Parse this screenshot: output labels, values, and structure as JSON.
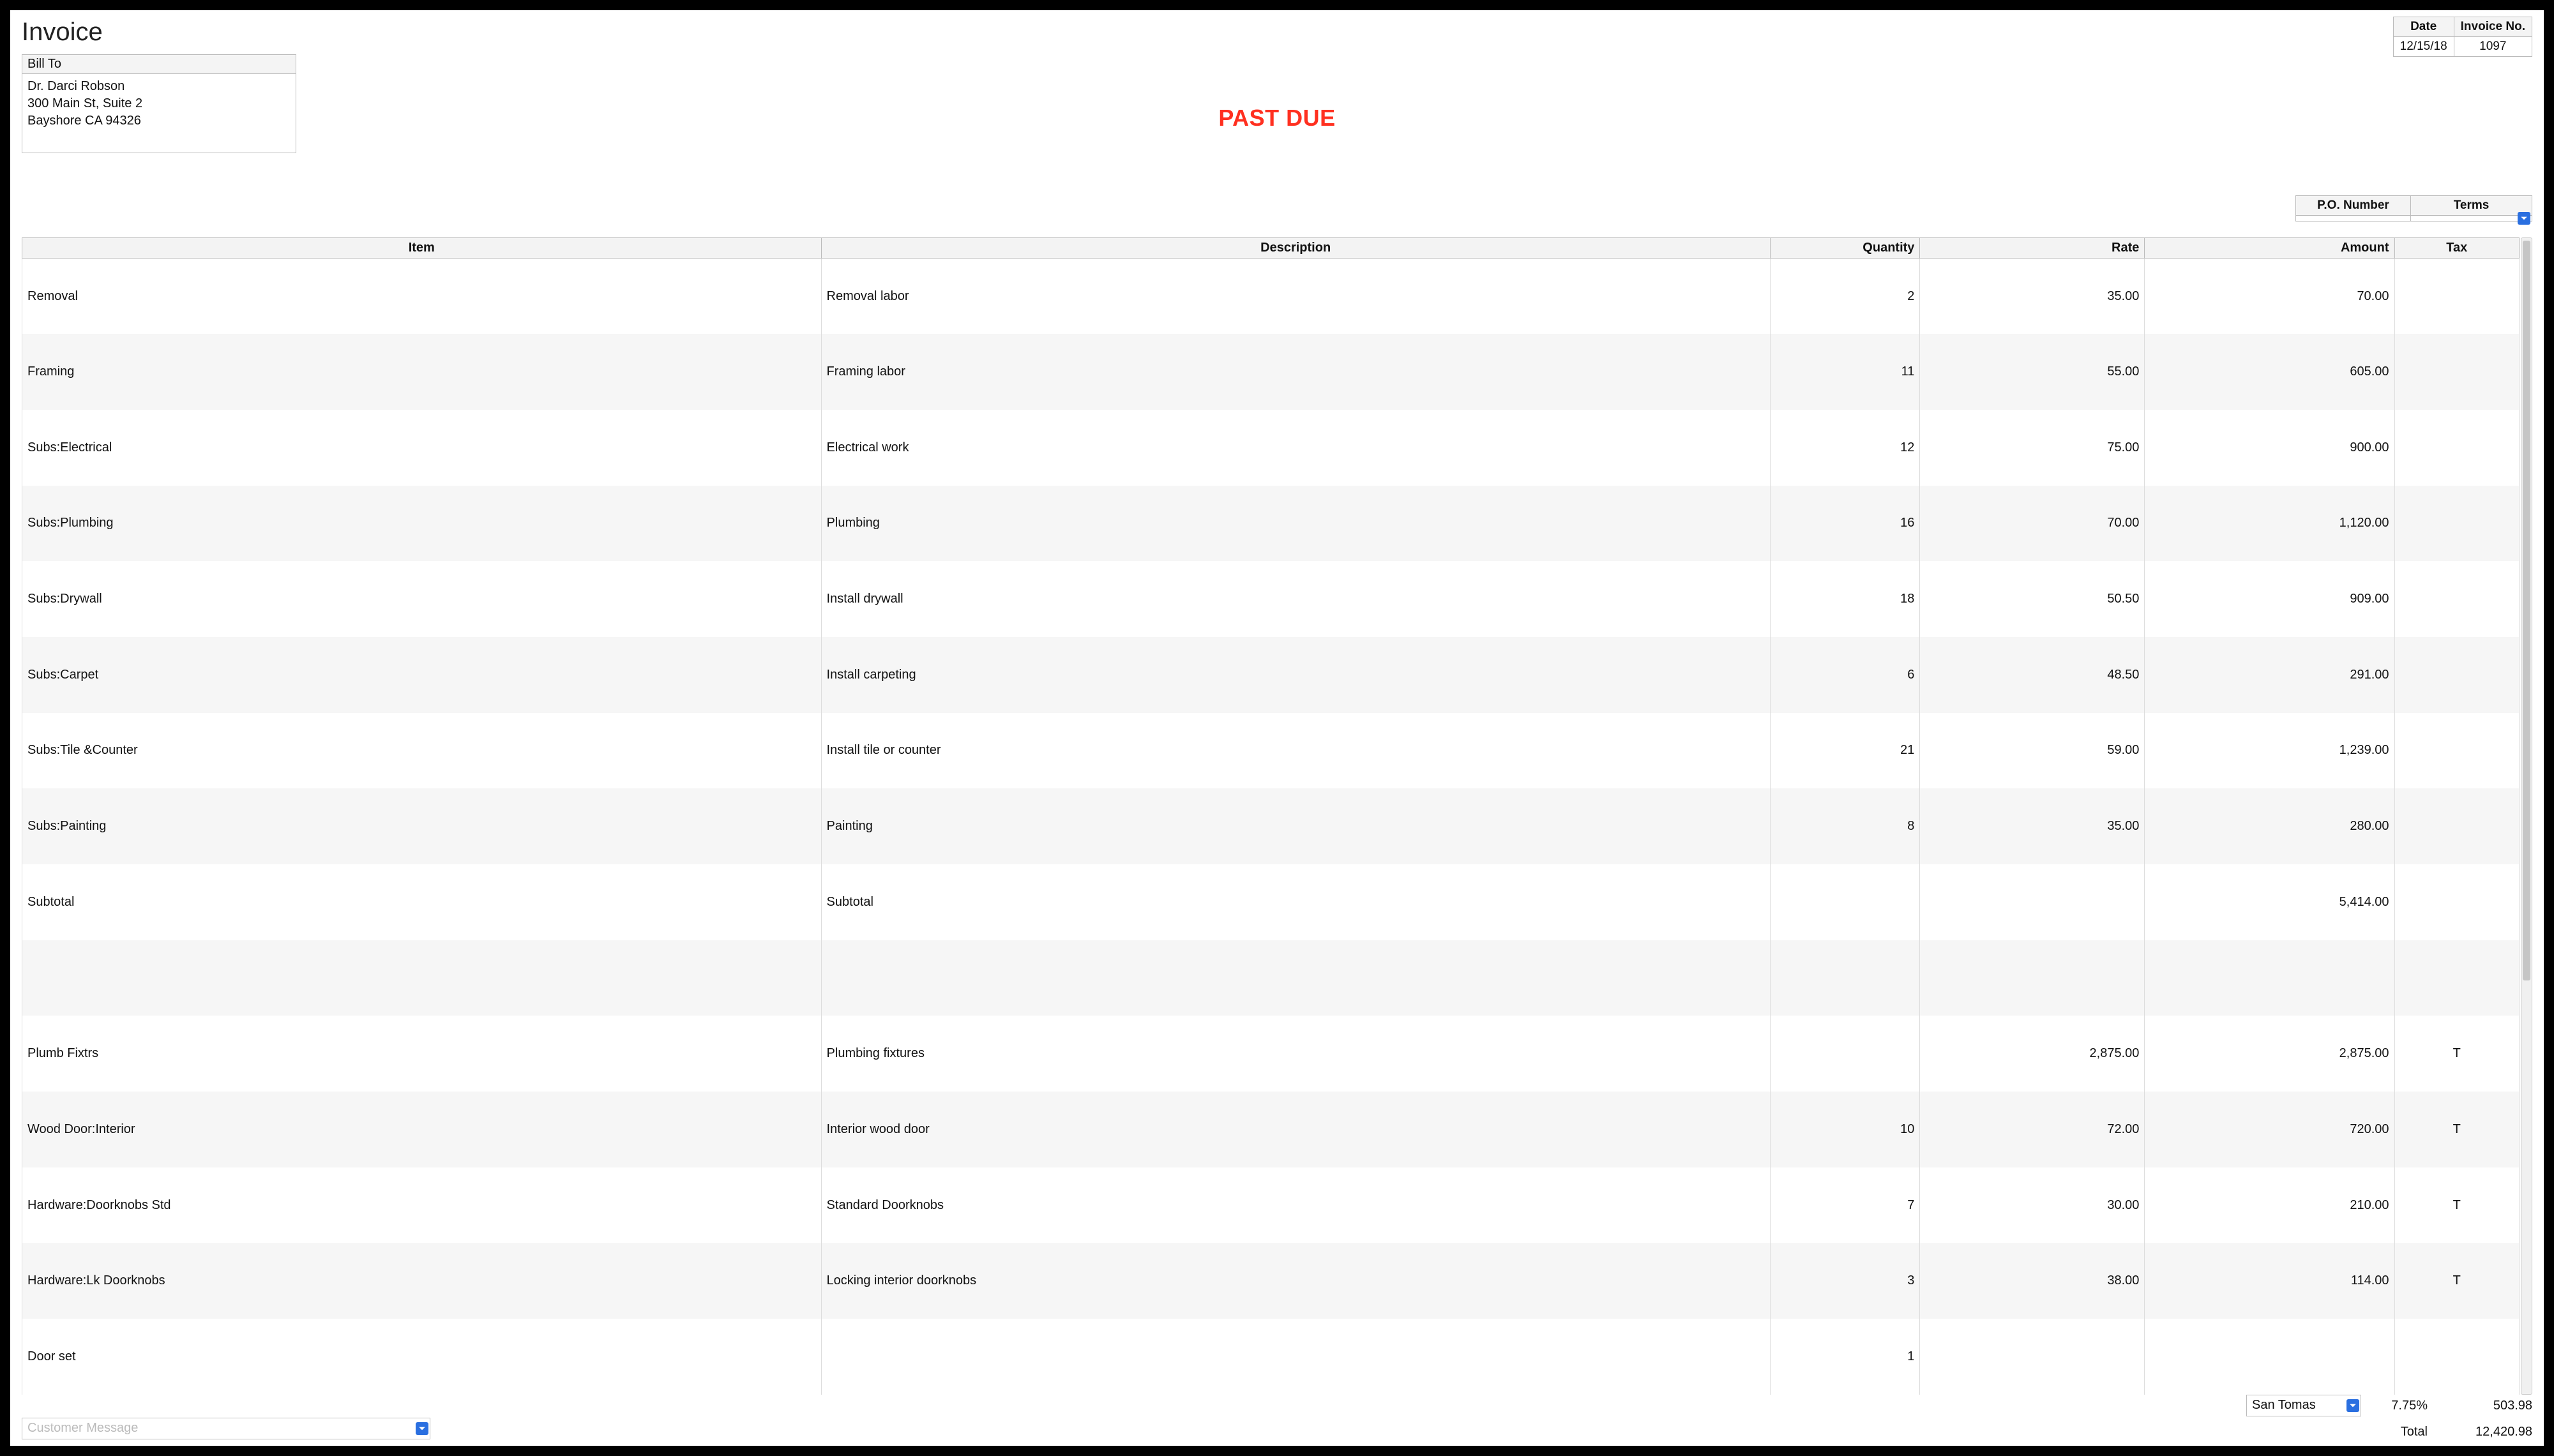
{
  "title": "Invoice",
  "stamp": "PAST DUE",
  "header": {
    "date_label": "Date",
    "date_value": "12/15/18",
    "invno_label": "Invoice No.",
    "invno_value": "1097"
  },
  "bill_to": {
    "label": "Bill To",
    "body": "Dr. Darci Robson\n300 Main St, Suite 2\nBayshore CA 94326"
  },
  "po_terms": {
    "po_label": "P.O. Number",
    "po_value": "",
    "terms_label": "Terms",
    "terms_value": ""
  },
  "columns": {
    "item": "Item",
    "desc": "Description",
    "qty": "Quantity",
    "rate": "Rate",
    "amount": "Amount",
    "tax": "Tax"
  },
  "lines": [
    {
      "item": "Removal",
      "desc": "Removal labor",
      "qty": "2",
      "rate": "35.00",
      "amount": "70.00",
      "tax": ""
    },
    {
      "item": "Framing",
      "desc": "Framing labor",
      "qty": "11",
      "rate": "55.00",
      "amount": "605.00",
      "tax": ""
    },
    {
      "item": "Subs:Electrical",
      "desc": "Electrical work",
      "qty": "12",
      "rate": "75.00",
      "amount": "900.00",
      "tax": ""
    },
    {
      "item": "Subs:Plumbing",
      "desc": "Plumbing",
      "qty": "16",
      "rate": "70.00",
      "amount": "1,120.00",
      "tax": ""
    },
    {
      "item": "Subs:Drywall",
      "desc": "Install drywall",
      "qty": "18",
      "rate": "50.50",
      "amount": "909.00",
      "tax": ""
    },
    {
      "item": "Subs:Carpet",
      "desc": "Install carpeting",
      "qty": "6",
      "rate": "48.50",
      "amount": "291.00",
      "tax": ""
    },
    {
      "item": "Subs:Tile &Counter",
      "desc": "Install tile or counter",
      "qty": "21",
      "rate": "59.00",
      "amount": "1,239.00",
      "tax": ""
    },
    {
      "item": "Subs:Painting",
      "desc": "Painting",
      "qty": "8",
      "rate": "35.00",
      "amount": "280.00",
      "tax": ""
    },
    {
      "item": "Subtotal",
      "desc": "Subtotal",
      "qty": "",
      "rate": "",
      "amount": "5,414.00",
      "tax": ""
    },
    {
      "item": "",
      "desc": "",
      "qty": "",
      "rate": "",
      "amount": "",
      "tax": ""
    },
    {
      "item": "Plumb Fixtrs",
      "desc": "Plumbing fixtures",
      "qty": "",
      "rate": "2,875.00",
      "amount": "2,875.00",
      "tax": "T"
    },
    {
      "item": "Wood Door:Interior",
      "desc": "Interior wood door",
      "qty": "10",
      "rate": "72.00",
      "amount": "720.00",
      "tax": "T"
    },
    {
      "item": "Hardware:Doorknobs Std",
      "desc": "Standard Doorknobs",
      "qty": "7",
      "rate": "30.00",
      "amount": "210.00",
      "tax": "T"
    },
    {
      "item": "Hardware:Lk Doorknobs",
      "desc": "Locking interior doorknobs",
      "qty": "3",
      "rate": "38.00",
      "amount": "114.00",
      "tax": "T"
    },
    {
      "item": "Door set",
      "desc": "",
      "qty": "1",
      "rate": "",
      "amount": "",
      "tax": ""
    }
  ],
  "footer": {
    "customer_message_placeholder": "Customer Message",
    "tax_jurisdiction": "San Tomas",
    "tax_pct": "7.75%",
    "tax_amount": "503.98",
    "total_label": "Total",
    "total_value": "12,420.98"
  }
}
